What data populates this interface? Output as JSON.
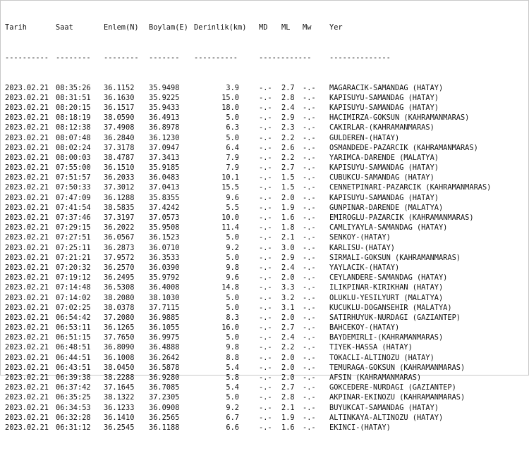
{
  "columns": {
    "date": "Tarih",
    "time": "Saat",
    "lat": "Enlem(N)",
    "lon": "Boylam(E)",
    "depth": "Derinlik(km)",
    "md": "MD",
    "ml": "ML",
    "mw": "Mw",
    "location": "Yer"
  },
  "separator": {
    "date": "----------",
    "time": "--------",
    "lat": "--------",
    "lon": "-------",
    "depth": "----------",
    "mag": "------------",
    "location": "--------------"
  },
  "rows": [
    {
      "date": "2023.02.21",
      "time": "08:35:26",
      "lat": "36.1152",
      "lon": "35.9498",
      "depth": "3.9",
      "md": "-.-",
      "ml": "2.7",
      "mw": "-.-",
      "location": "MAGARACIK-SAMANDAG (HATAY)"
    },
    {
      "date": "2023.02.21",
      "time": "08:31:51",
      "lat": "36.1630",
      "lon": "35.9225",
      "depth": "15.0",
      "md": "-.-",
      "ml": "2.8",
      "mw": "-.-",
      "location": "KAPISUYU-SAMANDAG (HATAY)"
    },
    {
      "date": "2023.02.21",
      "time": "08:20:15",
      "lat": "36.1517",
      "lon": "35.9433",
      "depth": "18.0",
      "md": "-.-",
      "ml": "2.4",
      "mw": "-.-",
      "location": "KAPISUYU-SAMANDAG (HATAY)"
    },
    {
      "date": "2023.02.21",
      "time": "08:18:19",
      "lat": "38.0590",
      "lon": "36.4913",
      "depth": "5.0",
      "md": "-.-",
      "ml": "2.9",
      "mw": "-.-",
      "location": "HACIMIRZA-GOKSUN (KAHRAMANMARAS)"
    },
    {
      "date": "2023.02.21",
      "time": "08:12:38",
      "lat": "37.4908",
      "lon": "36.8978",
      "depth": "6.3",
      "md": "-.-",
      "ml": "2.3",
      "mw": "-.-",
      "location": "CAKIRLAR-(KAHRAMANMARAS)"
    },
    {
      "date": "2023.02.21",
      "time": "08:07:48",
      "lat": "36.2840",
      "lon": "36.1230",
      "depth": "5.0",
      "md": "-.-",
      "ml": "2.2",
      "mw": "-.-",
      "location": "GULDEREN-(HATAY)"
    },
    {
      "date": "2023.02.21",
      "time": "08:02:24",
      "lat": "37.3178",
      "lon": "37.0947",
      "depth": "6.4",
      "md": "-.-",
      "ml": "2.6",
      "mw": "-.-",
      "location": "OSMANDEDE-PAZARCIK (KAHRAMANMARAS)"
    },
    {
      "date": "2023.02.21",
      "time": "08:00:03",
      "lat": "38.4787",
      "lon": "37.3413",
      "depth": "7.9",
      "md": "-.-",
      "ml": "2.2",
      "mw": "-.-",
      "location": "YARIMCA-DARENDE (MALATYA)"
    },
    {
      "date": "2023.02.21",
      "time": "07:55:00",
      "lat": "36.1510",
      "lon": "35.9185",
      "depth": "7.9",
      "md": "-.-",
      "ml": "2.7",
      "mw": "-.-",
      "location": "KAPISUYU-SAMANDAG (HATAY)"
    },
    {
      "date": "2023.02.21",
      "time": "07:51:57",
      "lat": "36.2033",
      "lon": "36.0483",
      "depth": "10.1",
      "md": "-.-",
      "ml": "1.5",
      "mw": "-.-",
      "location": "CUBUKCU-SAMANDAG (HATAY)"
    },
    {
      "date": "2023.02.21",
      "time": "07:50:33",
      "lat": "37.3012",
      "lat2": "",
      "lon": "37.0413",
      "depth": "15.5",
      "md": "-.-",
      "ml": "1.5",
      "mw": "-.-",
      "location": "CENNETPINARI-PAZARCIK (KAHRAMANMARAS)"
    },
    {
      "date": "2023.02.21",
      "time": "07:47:09",
      "lat": "36.1288",
      "lon": "35.8355",
      "depth": "9.6",
      "md": "-.-",
      "ml": "2.0",
      "mw": "-.-",
      "location": "KAPISUYU-SAMANDAG (HATAY)"
    },
    {
      "date": "2023.02.21",
      "time": "07:41:54",
      "lat": "38.5835",
      "lon": "37.4242",
      "depth": "5.5",
      "md": "-.-",
      "ml": "1.9",
      "mw": "-.-",
      "location": "GUNPINAR-DARENDE (MALATYA)"
    },
    {
      "date": "2023.02.21",
      "time": "07:37:46",
      "lat": "37.3197",
      "lon": "37.0573",
      "depth": "10.0",
      "md": "-.-",
      "ml": "1.6",
      "mw": "-.-",
      "location": "EMIROGLU-PAZARCIK (KAHRAMANMARAS)"
    },
    {
      "date": "2023.02.21",
      "time": "07:29:15",
      "lat": "36.2022",
      "lon": "35.9508",
      "depth": "11.4",
      "md": "-.-",
      "ml": "1.8",
      "mw": "-.-",
      "location": "CAMLIYAYLA-SAMANDAG (HATAY)"
    },
    {
      "date": "2023.02.21",
      "time": "07:27:51",
      "lat": "36.0567",
      "lon": "36.1523",
      "depth": "5.0",
      "md": "-.-",
      "ml": "2.1",
      "mw": "-.-",
      "location": "SENKOY-(HATAY)"
    },
    {
      "date": "2023.02.21",
      "time": "07:25:11",
      "lat": "36.2873",
      "lon": "36.0710",
      "depth": "9.2",
      "md": "-.-",
      "ml": "3.0",
      "mw": "-.-",
      "location": "KARLISU-(HATAY)"
    },
    {
      "date": "2023.02.21",
      "time": "07:21:21",
      "lat": "37.9572",
      "lon": "36.3533",
      "depth": "5.0",
      "md": "-.-",
      "ml": "2.9",
      "mw": "-.-",
      "location": "SIRMALI-GOKSUN (KAHRAMANMARAS)"
    },
    {
      "date": "2023.02.21",
      "time": "07:20:32",
      "lat": "36.2570",
      "lon": "36.0390",
      "depth": "9.8",
      "md": "-.-",
      "ml": "2.4",
      "mw": "-.-",
      "location": "YAYLACIK-(HATAY)"
    },
    {
      "date": "2023.02.21",
      "time": "07:19:12",
      "lat": "36.2495",
      "lon": "35.9792",
      "depth": "9.6",
      "md": "-.-",
      "ml": "2.0",
      "mw": "-.-",
      "location": "CEYLANDERE-SAMANDAG (HATAY)"
    },
    {
      "date": "2023.02.21",
      "time": "07:14:48",
      "lat": "36.5308",
      "lon": "36.4008",
      "depth": "14.8",
      "md": "-.-",
      "ml": "3.3",
      "mw": "-.-",
      "location": "ILIKPINAR-KIRIKHAN (HATAY)"
    },
    {
      "date": "2023.02.21",
      "time": "07:14:02",
      "lat": "38.2080",
      "lon": "38.1030",
      "depth": "5.0",
      "md": "-.-",
      "ml": "3.2",
      "mw": "-.-",
      "location": "OLUKLU-YESILYURT (MALATYA)"
    },
    {
      "date": "2023.02.21",
      "time": "07:02:25",
      "lat": "38.0378",
      "lon": "37.7115",
      "depth": "5.0",
      "md": "-.-",
      "ml": "3.1",
      "mw": "-.-",
      "location": "KUCUKLU-DOGANSEHIR (MALATYA)"
    },
    {
      "date": "2023.02.21",
      "time": "06:54:42",
      "lat": "37.2080",
      "lon": "36.9885",
      "depth": "8.3",
      "md": "-.-",
      "ml": "2.0",
      "mw": "-.-",
      "location": "SATIRHUYUK-NURDAGI (GAZIANTEP)"
    },
    {
      "date": "2023.02.21",
      "time": "06:53:11",
      "lat": "36.1265",
      "lon": "36.1055",
      "depth": "16.0",
      "md": "-.-",
      "ml": "2.7",
      "mw": "-.-",
      "location": "BAHCEKOY-(HATAY)"
    },
    {
      "date": "2023.02.21",
      "time": "06:51:15",
      "lat": "37.7650",
      "lon": "36.9975",
      "depth": "5.0",
      "md": "-.-",
      "ml": "2.4",
      "mw": "-.-",
      "location": "BAYDEMIRLI-(KAHRAMANMARAS)"
    },
    {
      "date": "2023.02.21",
      "time": "06:48:51",
      "lat": "36.8090",
      "lon": "36.4888",
      "depth": "9.8",
      "md": "-.-",
      "ml": "2.2",
      "mw": "-.-",
      "location": "TIYEK-HASSA (HATAY)"
    },
    {
      "date": "2023.02.21",
      "time": "06:44:51",
      "lat": "36.1008",
      "lon": "36.2642",
      "depth": "8.8",
      "md": "-.-",
      "ml": "2.0",
      "mw": "-.-",
      "location": "TOKACLI-ALTINOZU (HATAY)"
    },
    {
      "date": "2023.02.21",
      "time": "06:43:51",
      "lat": "38.0450",
      "lon": "36.5878",
      "depth": "5.4",
      "md": "-.-",
      "ml": "2.0",
      "mw": "-.-",
      "location": "TEMURAGA-GOKSUN (KAHRAMANMARAS)"
    },
    {
      "date": "2023.02.21",
      "time": "06:39:38",
      "lat": "38.2288",
      "lon": "36.9280",
      "depth": "5.8",
      "md": "-.-",
      "ml": "2.0",
      "mw": "-.-",
      "location": "AFSIN (KAHRAMANMARAS)"
    },
    {
      "date": "2023.02.21",
      "time": "06:37:42",
      "lat": "37.1645",
      "lon": "36.7085",
      "depth": "5.4",
      "md": "-.-",
      "ml": "2.7",
      "mw": "-.-",
      "location": "GOKCEDERE-NURDAGI (GAZIANTEP)"
    },
    {
      "date": "2023.02.21",
      "time": "06:35:25",
      "lat": "38.1322",
      "lon": "37.2305",
      "depth": "5.0",
      "md": "-.-",
      "ml": "2.8",
      "mw": "-.-",
      "location": "AKPINAR-EKINOZU (KAHRAMANMARAS)"
    },
    {
      "date": "2023.02.21",
      "time": "06:34:53",
      "lat": "36.1233",
      "lon": "36.0908",
      "depth": "9.2",
      "md": "-.-",
      "ml": "2.1",
      "mw": "-.-",
      "location": "BUYUKCAT-SAMANDAG (HATAY)"
    },
    {
      "date": "2023.02.21",
      "time": "06:32:28",
      "lat": "36.1410",
      "lon": "36.2565",
      "depth": "6.7",
      "md": "-.-",
      "ml": "1.9",
      "mw": "-.-",
      "location": "ALTINKAYA-ALTINOZU (HATAY)"
    },
    {
      "date": "2023.02.21",
      "time": "06:31:12",
      "lat": "36.2545",
      "lon": "36.1188",
      "depth": "6.6",
      "md": "-.-",
      "ml": "1.6",
      "mw": "-.-",
      "location": "EKINCI-(HATAY)"
    }
  ]
}
